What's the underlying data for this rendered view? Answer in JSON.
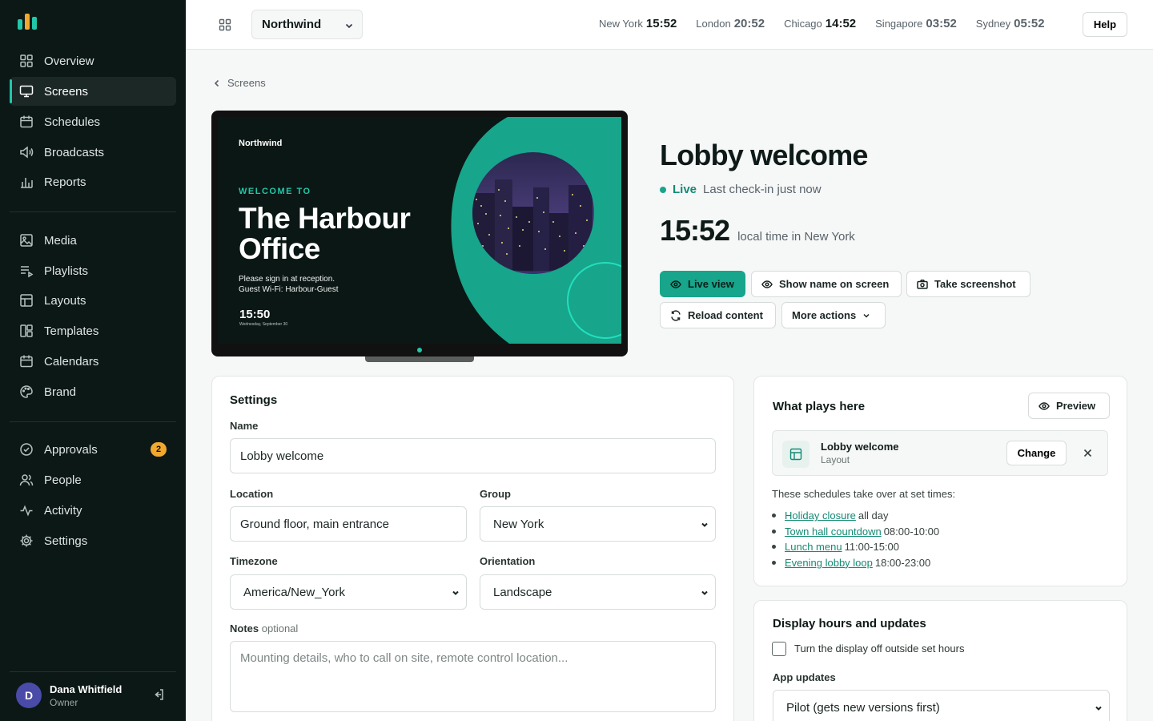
{
  "sidebar": {
    "nav_primary": [
      {
        "label": "Overview",
        "icon": "overview-icon"
      },
      {
        "label": "Screens",
        "icon": "monitor-icon",
        "active": true
      },
      {
        "label": "Schedules",
        "icon": "calendar-icon"
      },
      {
        "label": "Broadcasts",
        "icon": "megaphone-icon"
      },
      {
        "label": "Reports",
        "icon": "bar-chart-icon"
      }
    ],
    "nav_content": [
      {
        "label": "Media",
        "icon": "image-icon"
      },
      {
        "label": "Playlists",
        "icon": "playlist-icon"
      },
      {
        "label": "Layouts",
        "icon": "layout-icon"
      },
      {
        "label": "Templates",
        "icon": "template-icon"
      },
      {
        "label": "Calendars",
        "icon": "calendar-icon"
      },
      {
        "label": "Brand",
        "icon": "palette-icon"
      }
    ],
    "nav_admin": [
      {
        "label": "Approvals",
        "icon": "check-circle-icon",
        "badge": "2"
      },
      {
        "label": "People",
        "icon": "people-icon"
      },
      {
        "label": "Activity",
        "icon": "activity-icon"
      },
      {
        "label": "Settings",
        "icon": "gear-icon"
      }
    ],
    "user": {
      "initial": "D",
      "name": "Dana Whitfield",
      "role": "Owner"
    }
  },
  "topbar": {
    "org": "Northwind",
    "clocks": [
      {
        "city": "New York",
        "time": "15:52"
      },
      {
        "city": "London",
        "time": "20:52"
      },
      {
        "city": "Chicago",
        "time": "14:52"
      },
      {
        "city": "Singapore",
        "time": "03:52"
      },
      {
        "city": "Sydney",
        "time": "05:52"
      }
    ],
    "help": "Help"
  },
  "breadcrumb": "Screens",
  "preview": {
    "brand": "Northwind",
    "welcome": "WELCOME TO",
    "title": "The Harbour Office",
    "line1": "Please sign in at reception.",
    "line2": "Guest Wi-Fi: Harbour-Guest",
    "time": "15:50",
    "date": "Wednesday, September 30"
  },
  "screen": {
    "title": "Lobby welcome",
    "status": "Live",
    "checkin": "Last check-in just now",
    "local_time": "15:52",
    "local_time_label": "local time in New York"
  },
  "actions": {
    "live_view": "Live view",
    "show_name": "Show name on screen",
    "screenshot": "Take screenshot",
    "reload": "Reload content",
    "more": "More actions"
  },
  "settings": {
    "heading": "Settings",
    "name_label": "Name",
    "name_value": "Lobby welcome",
    "location_label": "Location",
    "location_value": "Ground floor, main entrance",
    "group_label": "Group",
    "group_value": "New York",
    "timezone_label": "Timezone",
    "timezone_value": "America/New_York",
    "orientation_label": "Orientation",
    "orientation_value": "Landscape",
    "notes_label": "Notes",
    "notes_optional": "optional",
    "notes_placeholder": "Mounting details, who to call on site, remote control location..."
  },
  "plays": {
    "heading": "What plays here",
    "preview": "Preview",
    "layout_name": "Lobby welcome",
    "layout_kind": "Layout",
    "change": "Change",
    "intro": "These schedules take over at set times:",
    "schedules": [
      {
        "name": "Holiday closure",
        "when": "all day"
      },
      {
        "name": "Town hall countdown",
        "when": "08:00-10:00"
      },
      {
        "name": "Lunch menu",
        "when": "11:00-15:00"
      },
      {
        "name": "Evening lobby loop",
        "when": "18:00-23:00"
      }
    ]
  },
  "display": {
    "heading": "Display hours and updates",
    "off_hours": "Turn the display off outside set hours",
    "off_hours_checked": false,
    "updates_label": "App updates",
    "updates_value": "Pilot (gets new versions first)"
  },
  "colors": {
    "accent": "#17a58b",
    "sidebar": "#0c1816",
    "badge": "#f0a92e"
  }
}
